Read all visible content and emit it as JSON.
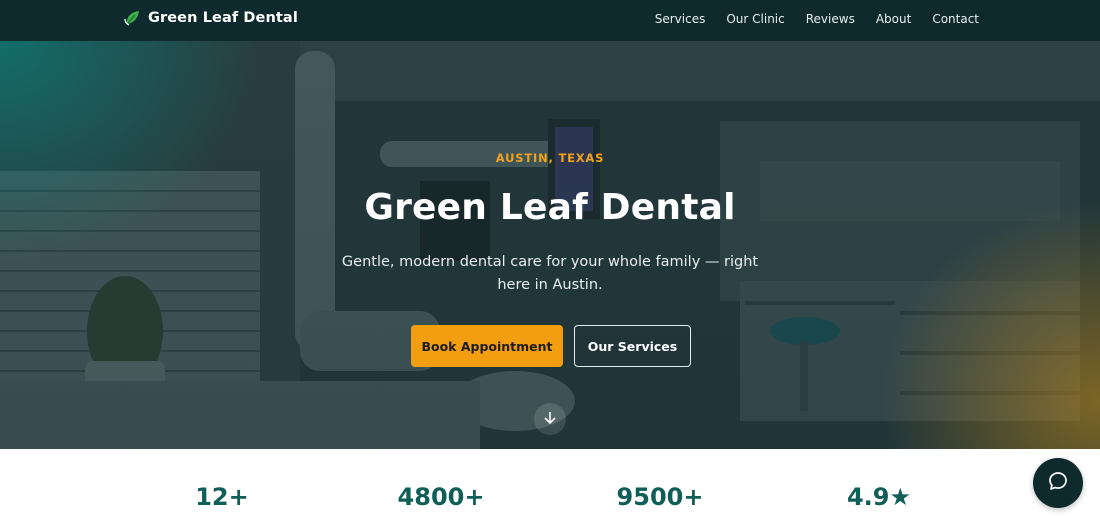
{
  "brand": {
    "name": "Green Leaf Dental",
    "icon": "leaf-icon"
  },
  "nav": {
    "links": [
      "Services",
      "Our Clinic",
      "Reviews",
      "About",
      "Contact"
    ]
  },
  "hero": {
    "eyebrow": "AUSTIN, TEXAS",
    "title": "Green Leaf Dental",
    "subtitle": "Gentle, modern dental care for your whole family — right here in Austin.",
    "primary_button": "Book Appointment",
    "secondary_button": "Our Services",
    "scroll_icon": "arrow-down-icon"
  },
  "stats": {
    "values": [
      "12+",
      "4800+",
      "9500+",
      "4.9★"
    ]
  },
  "chat": {
    "icon": "chat-bubble-icon"
  },
  "colors": {
    "nav_bg": "#0e2a2c",
    "accent": "#f29e10",
    "stat_text": "#0f5e57"
  }
}
